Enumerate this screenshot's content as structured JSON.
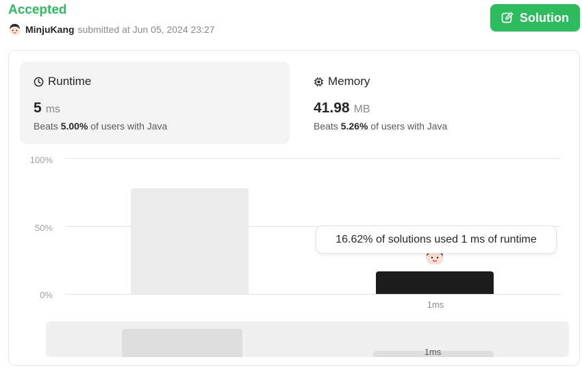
{
  "submission": {
    "status": "Accepted",
    "username": "MinjuKang",
    "submitted_text": "submitted at Jun 05, 2024 23:27"
  },
  "solution_button": {
    "label": "Solution",
    "icon": "edit-icon"
  },
  "runtime": {
    "title": "Runtime",
    "icon": "clock-icon",
    "value": "5",
    "unit": "ms",
    "beats_prefix": "Beats",
    "beats_pct": "5.00%",
    "beats_suffix": "of users with Java"
  },
  "memory": {
    "title": "Memory",
    "icon": "chip-icon",
    "value": "41.98",
    "unit": "MB",
    "beats_prefix": "Beats",
    "beats_pct": "5.26%",
    "beats_suffix": "of users with Java"
  },
  "chart": {
    "y_ticks": [
      "100%",
      "50%",
      "0%"
    ],
    "x_label": "1ms",
    "tooltip": "16.62% of solutions used 1 ms of runtime",
    "overview_label": "1ms"
  },
  "chart_data": {
    "type": "bar",
    "title": "",
    "ylabel": "",
    "xlabel": "",
    "ylim": [
      0,
      100
    ],
    "categories": [
      "",
      "1ms"
    ],
    "values": [
      78,
      16.62
    ],
    "highlight_index": 1,
    "grid": true
  },
  "colors": {
    "accent": "#2cbb5d",
    "user_bar": "#1c1c1c",
    "other_bar": "#ebebeb"
  }
}
